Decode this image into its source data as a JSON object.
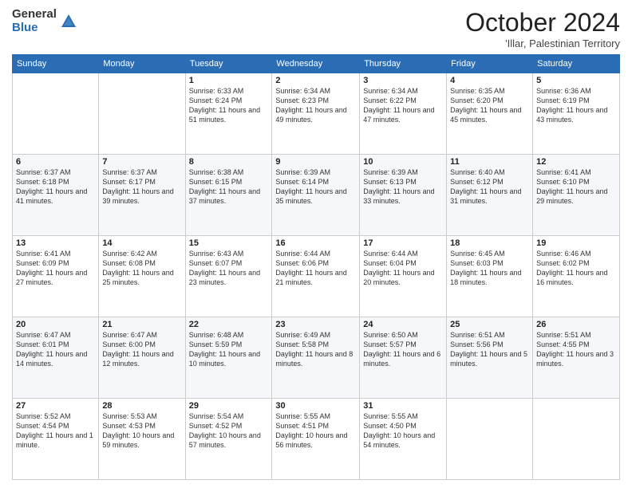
{
  "logo": {
    "general": "General",
    "blue": "Blue"
  },
  "header": {
    "month": "October 2024",
    "subtitle": "'Illar, Palestinian Territory"
  },
  "days_of_week": [
    "Sunday",
    "Monday",
    "Tuesday",
    "Wednesday",
    "Thursday",
    "Friday",
    "Saturday"
  ],
  "weeks": [
    [
      {
        "day": "",
        "info": ""
      },
      {
        "day": "",
        "info": ""
      },
      {
        "day": "1",
        "info": "Sunrise: 6:33 AM\nSunset: 6:24 PM\nDaylight: 11 hours and 51 minutes."
      },
      {
        "day": "2",
        "info": "Sunrise: 6:34 AM\nSunset: 6:23 PM\nDaylight: 11 hours and 49 minutes."
      },
      {
        "day": "3",
        "info": "Sunrise: 6:34 AM\nSunset: 6:22 PM\nDaylight: 11 hours and 47 minutes."
      },
      {
        "day": "4",
        "info": "Sunrise: 6:35 AM\nSunset: 6:20 PM\nDaylight: 11 hours and 45 minutes."
      },
      {
        "day": "5",
        "info": "Sunrise: 6:36 AM\nSunset: 6:19 PM\nDaylight: 11 hours and 43 minutes."
      }
    ],
    [
      {
        "day": "6",
        "info": "Sunrise: 6:37 AM\nSunset: 6:18 PM\nDaylight: 11 hours and 41 minutes."
      },
      {
        "day": "7",
        "info": "Sunrise: 6:37 AM\nSunset: 6:17 PM\nDaylight: 11 hours and 39 minutes."
      },
      {
        "day": "8",
        "info": "Sunrise: 6:38 AM\nSunset: 6:15 PM\nDaylight: 11 hours and 37 minutes."
      },
      {
        "day": "9",
        "info": "Sunrise: 6:39 AM\nSunset: 6:14 PM\nDaylight: 11 hours and 35 minutes."
      },
      {
        "day": "10",
        "info": "Sunrise: 6:39 AM\nSunset: 6:13 PM\nDaylight: 11 hours and 33 minutes."
      },
      {
        "day": "11",
        "info": "Sunrise: 6:40 AM\nSunset: 6:12 PM\nDaylight: 11 hours and 31 minutes."
      },
      {
        "day": "12",
        "info": "Sunrise: 6:41 AM\nSunset: 6:10 PM\nDaylight: 11 hours and 29 minutes."
      }
    ],
    [
      {
        "day": "13",
        "info": "Sunrise: 6:41 AM\nSunset: 6:09 PM\nDaylight: 11 hours and 27 minutes."
      },
      {
        "day": "14",
        "info": "Sunrise: 6:42 AM\nSunset: 6:08 PM\nDaylight: 11 hours and 25 minutes."
      },
      {
        "day": "15",
        "info": "Sunrise: 6:43 AM\nSunset: 6:07 PM\nDaylight: 11 hours and 23 minutes."
      },
      {
        "day": "16",
        "info": "Sunrise: 6:44 AM\nSunset: 6:06 PM\nDaylight: 11 hours and 21 minutes."
      },
      {
        "day": "17",
        "info": "Sunrise: 6:44 AM\nSunset: 6:04 PM\nDaylight: 11 hours and 20 minutes."
      },
      {
        "day": "18",
        "info": "Sunrise: 6:45 AM\nSunset: 6:03 PM\nDaylight: 11 hours and 18 minutes."
      },
      {
        "day": "19",
        "info": "Sunrise: 6:46 AM\nSunset: 6:02 PM\nDaylight: 11 hours and 16 minutes."
      }
    ],
    [
      {
        "day": "20",
        "info": "Sunrise: 6:47 AM\nSunset: 6:01 PM\nDaylight: 11 hours and 14 minutes."
      },
      {
        "day": "21",
        "info": "Sunrise: 6:47 AM\nSunset: 6:00 PM\nDaylight: 11 hours and 12 minutes."
      },
      {
        "day": "22",
        "info": "Sunrise: 6:48 AM\nSunset: 5:59 PM\nDaylight: 11 hours and 10 minutes."
      },
      {
        "day": "23",
        "info": "Sunrise: 6:49 AM\nSunset: 5:58 PM\nDaylight: 11 hours and 8 minutes."
      },
      {
        "day": "24",
        "info": "Sunrise: 6:50 AM\nSunset: 5:57 PM\nDaylight: 11 hours and 6 minutes."
      },
      {
        "day": "25",
        "info": "Sunrise: 6:51 AM\nSunset: 5:56 PM\nDaylight: 11 hours and 5 minutes."
      },
      {
        "day": "26",
        "info": "Sunrise: 5:51 AM\nSunset: 4:55 PM\nDaylight: 11 hours and 3 minutes."
      }
    ],
    [
      {
        "day": "27",
        "info": "Sunrise: 5:52 AM\nSunset: 4:54 PM\nDaylight: 11 hours and 1 minute."
      },
      {
        "day": "28",
        "info": "Sunrise: 5:53 AM\nSunset: 4:53 PM\nDaylight: 10 hours and 59 minutes."
      },
      {
        "day": "29",
        "info": "Sunrise: 5:54 AM\nSunset: 4:52 PM\nDaylight: 10 hours and 57 minutes."
      },
      {
        "day": "30",
        "info": "Sunrise: 5:55 AM\nSunset: 4:51 PM\nDaylight: 10 hours and 56 minutes."
      },
      {
        "day": "31",
        "info": "Sunrise: 5:55 AM\nSunset: 4:50 PM\nDaylight: 10 hours and 54 minutes."
      },
      {
        "day": "",
        "info": ""
      },
      {
        "day": "",
        "info": ""
      }
    ]
  ]
}
